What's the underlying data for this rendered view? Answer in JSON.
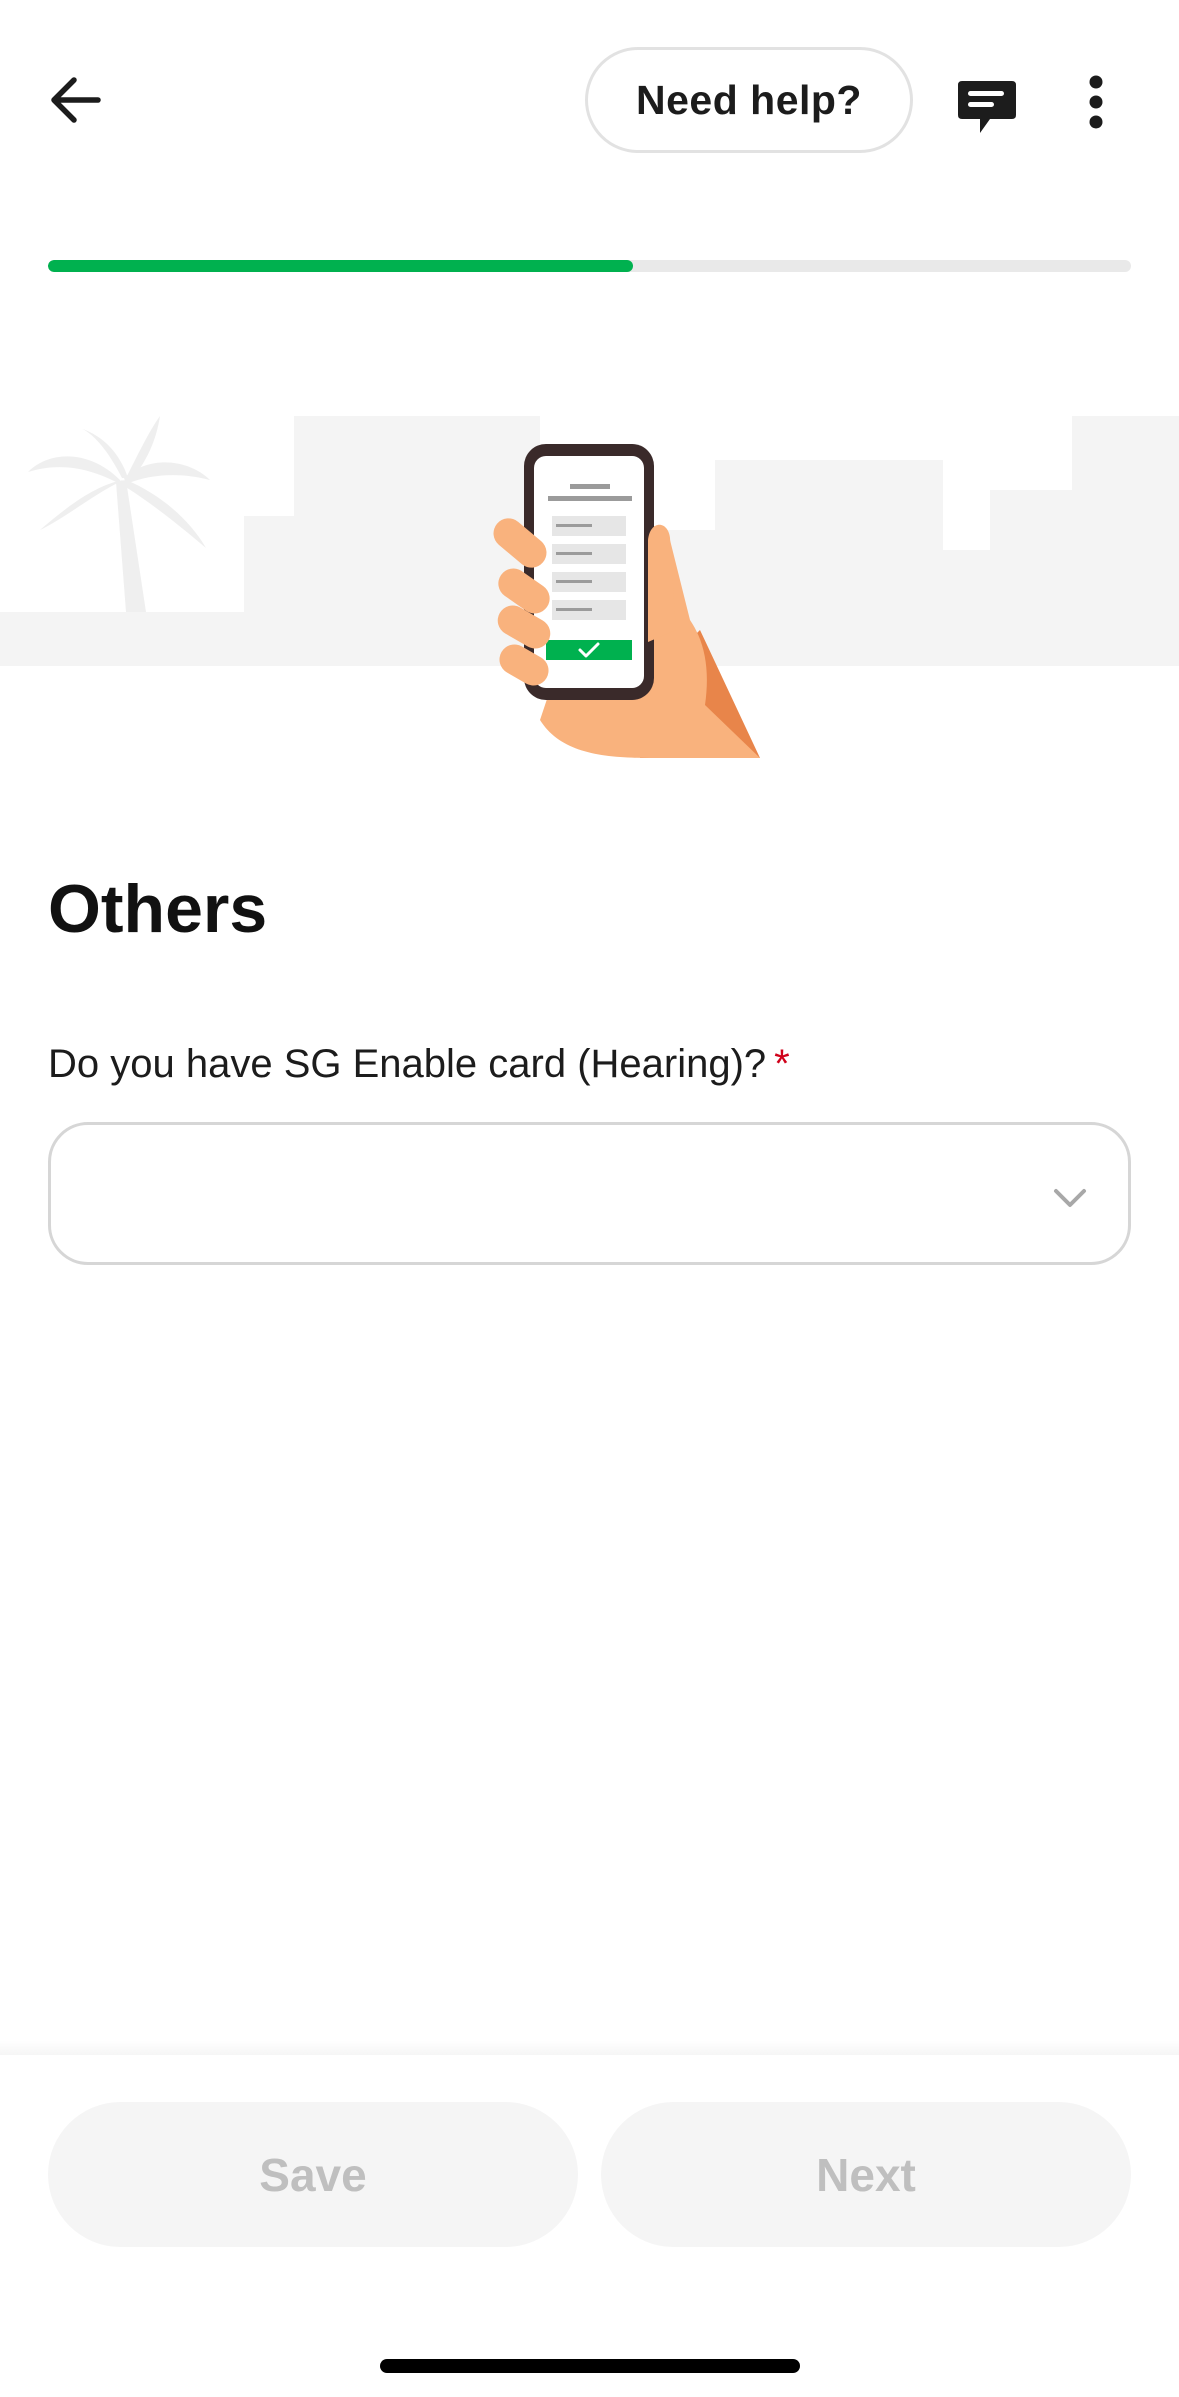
{
  "header": {
    "help_label": "Need help?"
  },
  "progress": {
    "value": 0.54
  },
  "section": {
    "title": "Others"
  },
  "form": {
    "question_label": "Do you have SG Enable card (Hearing)?",
    "required_marker": "*",
    "select_value": ""
  },
  "footer": {
    "save_label": "Save",
    "next_label": "Next"
  },
  "colors": {
    "accent": "#00b14f",
    "required": "#d0021b",
    "disabled_text": "#bfbfbf",
    "disabled_bg": "#f5f5f5"
  },
  "icons": {
    "back": "arrow-left-icon",
    "chat": "chat-bubble-icon",
    "more": "more-vertical-icon",
    "dropdown": "chevron-down-icon"
  }
}
